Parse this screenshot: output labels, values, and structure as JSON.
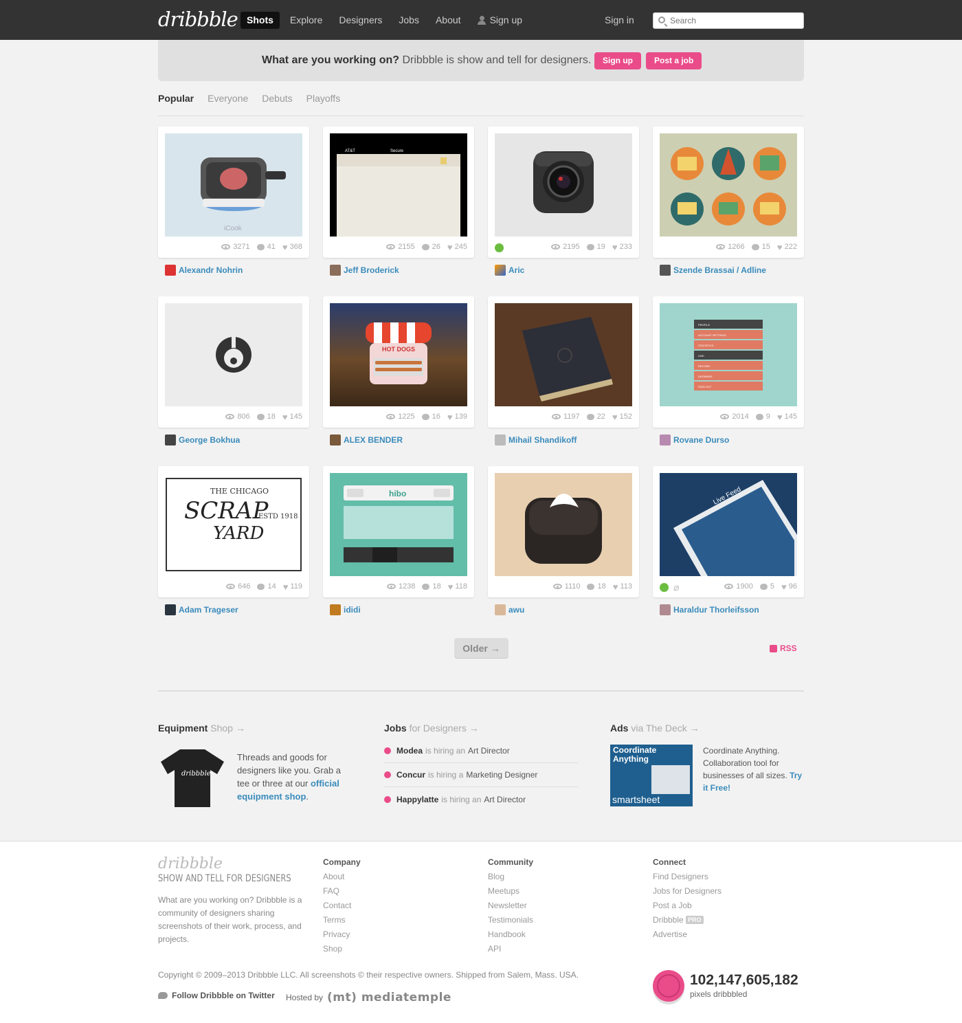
{
  "header": {
    "logo": "dribbble",
    "nav": [
      "Shots",
      "Explore",
      "Designers",
      "Jobs",
      "About",
      "Sign up"
    ],
    "signin": "Sign in",
    "search_placeholder": "Search"
  },
  "banner": {
    "question": "What are you working on?",
    "text": " Dribbble is show and tell for designers.",
    "signup": "Sign up",
    "post_job": "Post a job"
  },
  "filters": [
    "Popular",
    "Everyone",
    "Debuts",
    "Playoffs"
  ],
  "shots": [
    {
      "views": "3271",
      "comments": "41",
      "likes": "368",
      "player": "Alexandr Nohrin"
    },
    {
      "views": "2155",
      "comments": "26",
      "likes": "245",
      "player": "Jeff Broderick"
    },
    {
      "views": "2195",
      "comments": "19",
      "likes": "233",
      "player": "Aric"
    },
    {
      "views": "1266",
      "comments": "15",
      "likes": "222",
      "player": "Szende Brassai / Adline"
    },
    {
      "views": "806",
      "comments": "18",
      "likes": "145",
      "player": "George Bokhua"
    },
    {
      "views": "1225",
      "comments": "16",
      "likes": "139",
      "player": "ALEX BENDER"
    },
    {
      "views": "1197",
      "comments": "22",
      "likes": "152",
      "player": "Mihail Shandikoff"
    },
    {
      "views": "2014",
      "comments": "9",
      "likes": "145",
      "player": "Rovane Durso"
    },
    {
      "views": "646",
      "comments": "14",
      "likes": "119",
      "player": "Adam Trageser"
    },
    {
      "views": "1238",
      "comments": "18",
      "likes": "118",
      "player": "ididi"
    },
    {
      "views": "1110",
      "comments": "18",
      "likes": "113",
      "player": "awu"
    },
    {
      "views": "1900",
      "comments": "5",
      "likes": "96",
      "player": "Haraldur Thorleifsson"
    }
  ],
  "thumb_text": {
    "icook": "iCook",
    "att": "AT&T",
    "secure": "Secure",
    "hotdogs": "HOT DOGS",
    "hibo": "hibo",
    "scrap_1": "THE CHICAGO",
    "scrap_2": "SCRAP",
    "scrap_3": "YARD",
    "scrap_4": "ESTD 1918",
    "menu": [
      "PROFILE",
      "ACCOUNT SETTINGS",
      "STATISTICS",
      "LINK",
      "RECORD",
      "DATABASE",
      "SIGN OUT"
    ],
    "live_feed": "Live Feed"
  },
  "pager": {
    "older": "Older →",
    "rss": "RSS"
  },
  "equipment": {
    "title_b": "Equipment",
    "title": " Shop →",
    "text": "Threads and goods for designers like you. Grab a tee or three at our ",
    "link": "official equipment shop",
    "tee_label": "dribbble"
  },
  "jobs": {
    "title_b": "Jobs",
    "title": " for Designers →",
    "items": [
      {
        "company": "Modea",
        "mid": "is hiring an",
        "role": "Art Director"
      },
      {
        "company": "Concur",
        "mid": "is hiring a",
        "role": "Marketing Designer"
      },
      {
        "company": "Happylatte",
        "mid": "is hiring an",
        "role": "Art Director"
      }
    ]
  },
  "ads": {
    "title_b": "Ads",
    "title": " via The Deck →",
    "img_headline": "Coordinate Anything",
    "img_brand": "smartsheet",
    "text": "Coordinate Anything. Collaboration tool for businesses of all sizes. ",
    "link": "Try it Free!"
  },
  "footer": {
    "logo": "dribbble",
    "tagline": "Show and tell for designers",
    "desc": "What are you working on? Dribbble is a community of designers sharing screenshots of their work, process, and projects.",
    "company": {
      "h": "Company",
      "links": [
        "About",
        "FAQ",
        "Contact",
        "Terms",
        "Privacy",
        "Shop"
      ]
    },
    "community": {
      "h": "Community",
      "links": [
        "Blog",
        "Meetups",
        "Newsletter",
        "Testimonials",
        "Handbook",
        "API"
      ]
    },
    "connect": {
      "h": "Connect",
      "links": [
        "Find Designers",
        "Jobs for Designers",
        "Post a Job",
        "Dribbble",
        "Advertise"
      ],
      "pro": "PRO"
    },
    "copyright": "Copyright © 2009–2013 Dribbble LLC. All screenshots © their respective owners. Shipped from Salem, Mass. USA.",
    "twitter": "Follow Dribbble on Twitter",
    "hosted": "Hosted by",
    "host": "(mt) mediatemple",
    "pixels": "102,147,605,182",
    "pixels_label": "pixels dribbbled"
  }
}
